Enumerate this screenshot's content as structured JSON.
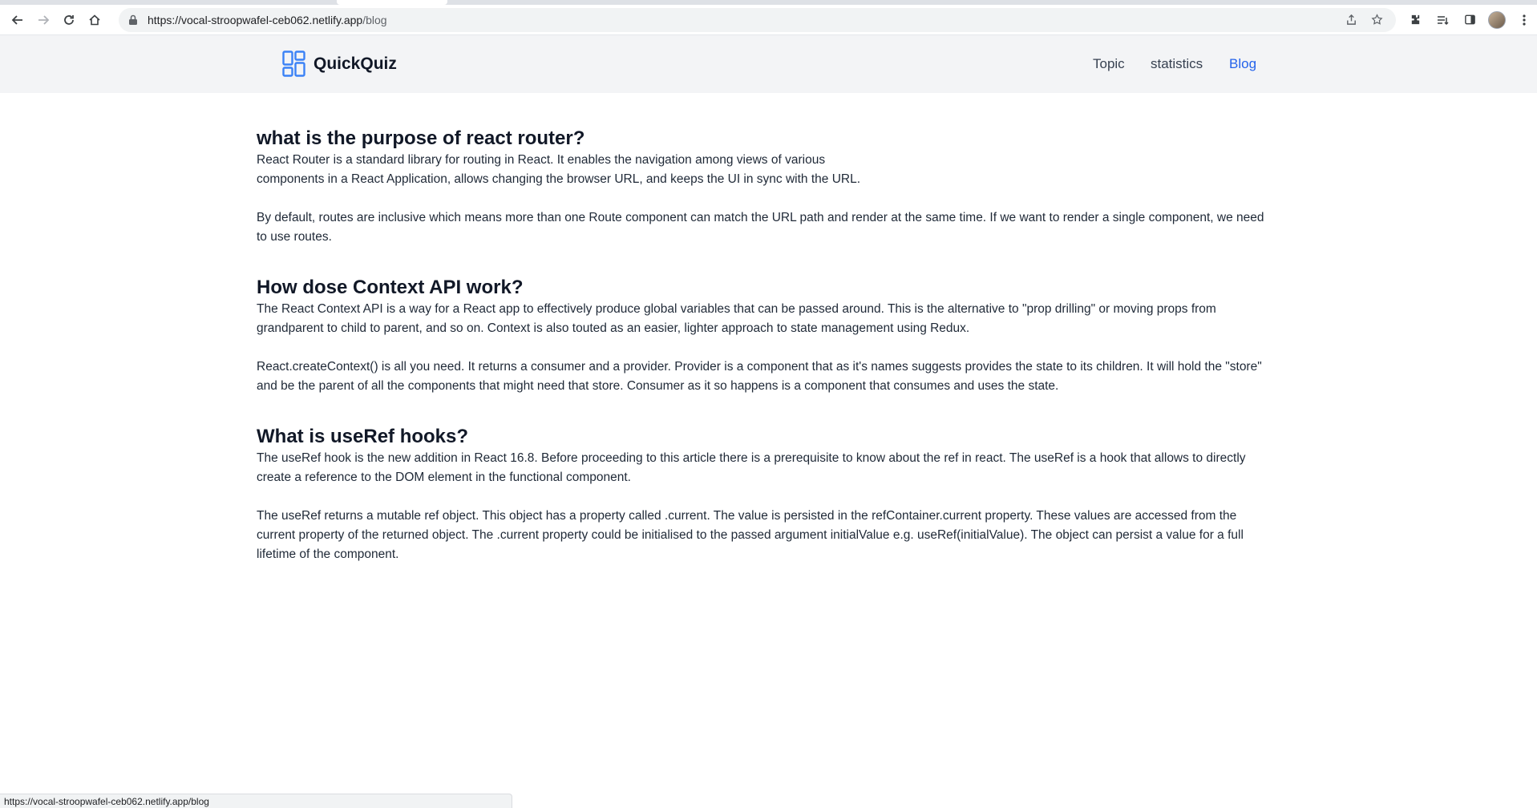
{
  "browser": {
    "url_host": "https://vocal-stroopwafel-ceb062.netlify.app",
    "url_path": "/blog",
    "status_url": "https://vocal-stroopwafel-ceb062.netlify.app/blog"
  },
  "site": {
    "brand": "QuickQuiz",
    "nav": [
      {
        "label": "Topic",
        "active": false
      },
      {
        "label": "statistics",
        "active": false
      },
      {
        "label": "Blog",
        "active": true
      }
    ],
    "accent": "#2563eb"
  },
  "posts": [
    {
      "question": "what is the purpose of react router?",
      "paragraphs": [
        "React Router is a standard library for routing in React. It enables the navigation among views of various components in a React Application, allows changing the browser URL, and keeps the UI in sync with the URL.",
        "By default, routes are inclusive which means more than one Route component can match the URL path and render at the same time. If we want to render a single component, we need to use routes."
      ]
    },
    {
      "question": "How dose Context API work?",
      "paragraphs": [
        "The React Context API is a way for a React app to effectively produce global variables that can be passed around. This is the alternative to \"prop drilling\" or moving props from grandparent to child to parent, and so on. Context is also touted as an easier, lighter approach to state management using Redux.",
        "React.createContext() is all you need. It returns a consumer and a provider. Provider is a component that as it's names suggests provides the state to its children. It will hold the \"store\" and be the parent of all the components that might need that store. Consumer as it so happens is a component that consumes and uses the state."
      ]
    },
    {
      "question": "What is useRef hooks?",
      "paragraphs": [
        "The useRef hook is the new addition in React 16.8. Before proceeding to this article there is a prerequisite to know about the ref in react. The useRef is a hook that allows to directly create a reference to the DOM element in the functional component.",
        "The useRef returns a mutable ref object. This object has a property called .current. The value is persisted in the refContainer.current property. These values are accessed from the current property of the returned object. The .current property could be initialised to the passed argument initialValue e.g. useRef(initialValue). The object can persist a value for a full lifetime of the component."
      ]
    }
  ]
}
